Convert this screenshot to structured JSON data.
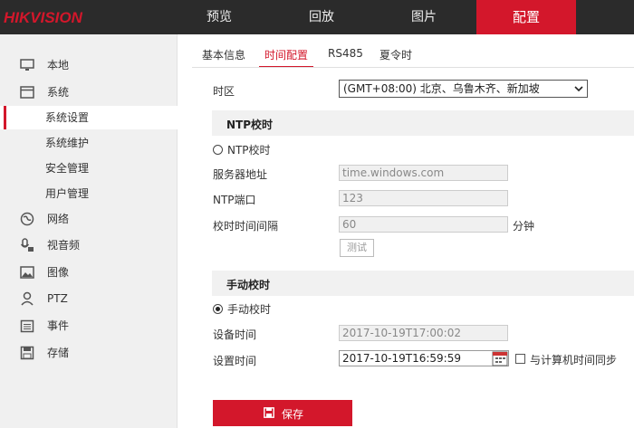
{
  "brand": "HIKVISION",
  "nav": [
    "预览",
    "回放",
    "图片",
    "配置"
  ],
  "sidebar": {
    "items": [
      {
        "label": "本地",
        "icon": "monitor-icon"
      },
      {
        "label": "系统",
        "icon": "window-icon"
      },
      {
        "label": "系统设置",
        "active": true
      },
      {
        "label": "系统维护"
      },
      {
        "label": "安全管理"
      },
      {
        "label": "用户管理"
      },
      {
        "label": "网络",
        "icon": "globe-icon"
      },
      {
        "label": "视音频",
        "icon": "mic-camera-icon"
      },
      {
        "label": "图像",
        "icon": "image-icon"
      },
      {
        "label": "PTZ",
        "icon": "ptz-user-icon"
      },
      {
        "label": "事件",
        "icon": "calendar-icon"
      },
      {
        "label": "存储",
        "icon": "save-icon"
      }
    ]
  },
  "tabs": [
    "基本信息",
    "时间配置",
    "RS485",
    "夏令时"
  ],
  "form": {
    "timezone_label": "时区",
    "timezone_value": "(GMT+08:00) 北京、乌鲁木齐、新加坡",
    "ntp_section": "NTP校时",
    "ntp_radio": "NTP校时",
    "server_label": "服务器地址",
    "server_value": "time.windows.com",
    "port_label": "NTP端口",
    "port_value": "123",
    "interval_label": "校时时间间隔",
    "interval_value": "60",
    "interval_unit": "分钟",
    "test_button": "测试",
    "manual_section": "手动校时",
    "manual_radio": "手动校时",
    "device_time_label": "设备时间",
    "device_time_value": "2017-10-19T17:00:02",
    "set_time_label": "设置时间",
    "set_time_value": "2017-10-19T16:59:59",
    "sync_label": "与计算机时间同步",
    "save_button": "保存"
  },
  "colors": {
    "accent": "#d3172b",
    "topbar": "#2b2b2b",
    "sidebar": "#f0f0f0"
  }
}
